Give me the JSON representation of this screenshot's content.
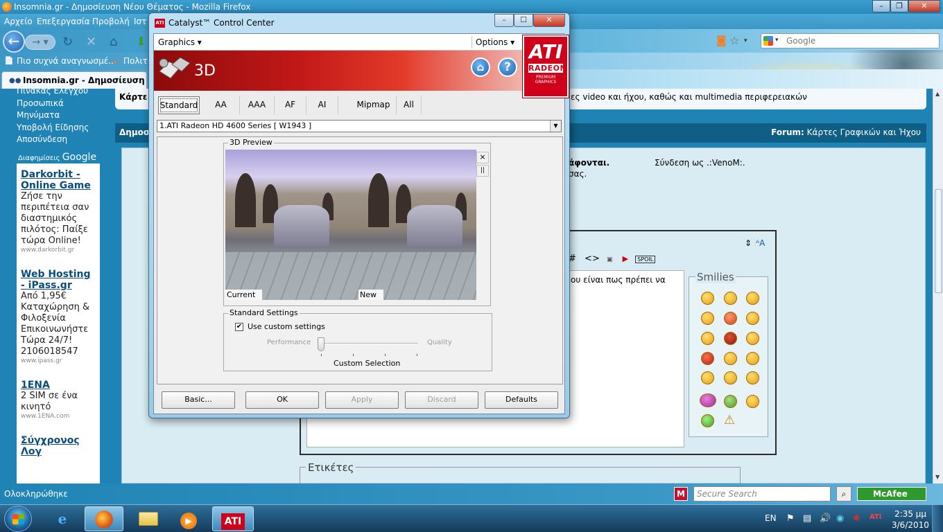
{
  "firefox": {
    "window_title": "Insomnia.gr - Δημοσίευση Νέου Θέματος - Mozilla Firefox",
    "menu": [
      "Αρχείο",
      "Επεξεργασία",
      "Προβολή",
      "Ιστ"
    ],
    "bookmarks": [
      "Πιο συχνά αναγνωσμέ...",
      "Πολιτ"
    ],
    "tab_title": "Insomnia.gr - Δημοσίευση Νέου Θ",
    "search_placeholder": "Google",
    "status": "Ολοκληρώθηκε"
  },
  "page": {
    "sidebar_links": [
      "Πίνακας Ελέγχου",
      "Προσωπικά Μηνύματα",
      "Υποβολή Είδησης",
      "Αποσύνδεση"
    ],
    "ads_header": {
      "prefix": "Διαφημίσεις",
      "brand": "Google"
    },
    "ads": [
      {
        "title": "Darkorbit - Online Game",
        "desc": "Ζήσε την περιπέτεια σαν διαστημικός πιλότος: Παίξε τώρα Online!",
        "url": "www.darkorbit.gr"
      },
      {
        "title": "Web Hosting - iPass.gr",
        "desc": "Από 1,95€ Καταχώρηση & Φιλοξενία Επικοινωνήστε Τώρα 24/7! 2106018547",
        "url": "www.ipass.gr"
      },
      {
        "title": "1ENA",
        "desc": "2 SIM σε ένα κινητό",
        "url": "www.1ENA.com"
      },
      {
        "title": "Σύγχρονος Λογ",
        "desc": "",
        "url": ""
      }
    ],
    "crumb_left": "Κάρτε",
    "crumb_right": "ες video και ήχου, καθώς και multimedia περιφερειακών",
    "forum_bar_left": "Δημοσ",
    "forum_bar_label": "Forum:",
    "forum_bar_value": "Κάρτες Γραφικών και Ήχου",
    "notice_bold": "άφονται.",
    "notice_small": "σας.",
    "login": "Σύνδεση ως .:VenoM:.",
    "editor_text": "ου είναι πως πρέπει να",
    "smilies_label": "Smilies",
    "tags_label": "Ετικέτες"
  },
  "mcafee": {
    "search_placeholder": "Secure Search",
    "badge": "McAfee"
  },
  "taskbar": {
    "lang": "EN",
    "time": "2:35 μμ",
    "date": "3/6/2010",
    "ati_label": "ATI"
  },
  "ccc": {
    "title": "Catalyst™ Control Center",
    "menu_graphics": "Graphics ▾",
    "menu_options": "Options ▾",
    "section": "3D",
    "logo": {
      "brand": "ATI",
      "product": "RADEON",
      "tag1": "PREMIUM",
      "tag2": "GRAPHICS"
    },
    "tabs": [
      "Standard",
      "AA",
      "AAA",
      "AF",
      "AI",
      "Mipmap",
      "All"
    ],
    "selected_tab": "Standard",
    "device": "1.ATI Radeon HD 4600 Series  [ W1943 ]",
    "preview_label": "3D Preview",
    "preview_current": "Current",
    "preview_new": "New",
    "std_label": "Standard Settings",
    "use_custom": "Use custom settings",
    "use_custom_checked": true,
    "performance": "Performance",
    "quality": "Quality",
    "custom_selection": "Custom Selection",
    "slider_value": 0,
    "buttons": {
      "basic": "Basic...",
      "ok": "OK",
      "apply": "Apply",
      "discard": "Discard",
      "defaults": "Defaults"
    }
  }
}
